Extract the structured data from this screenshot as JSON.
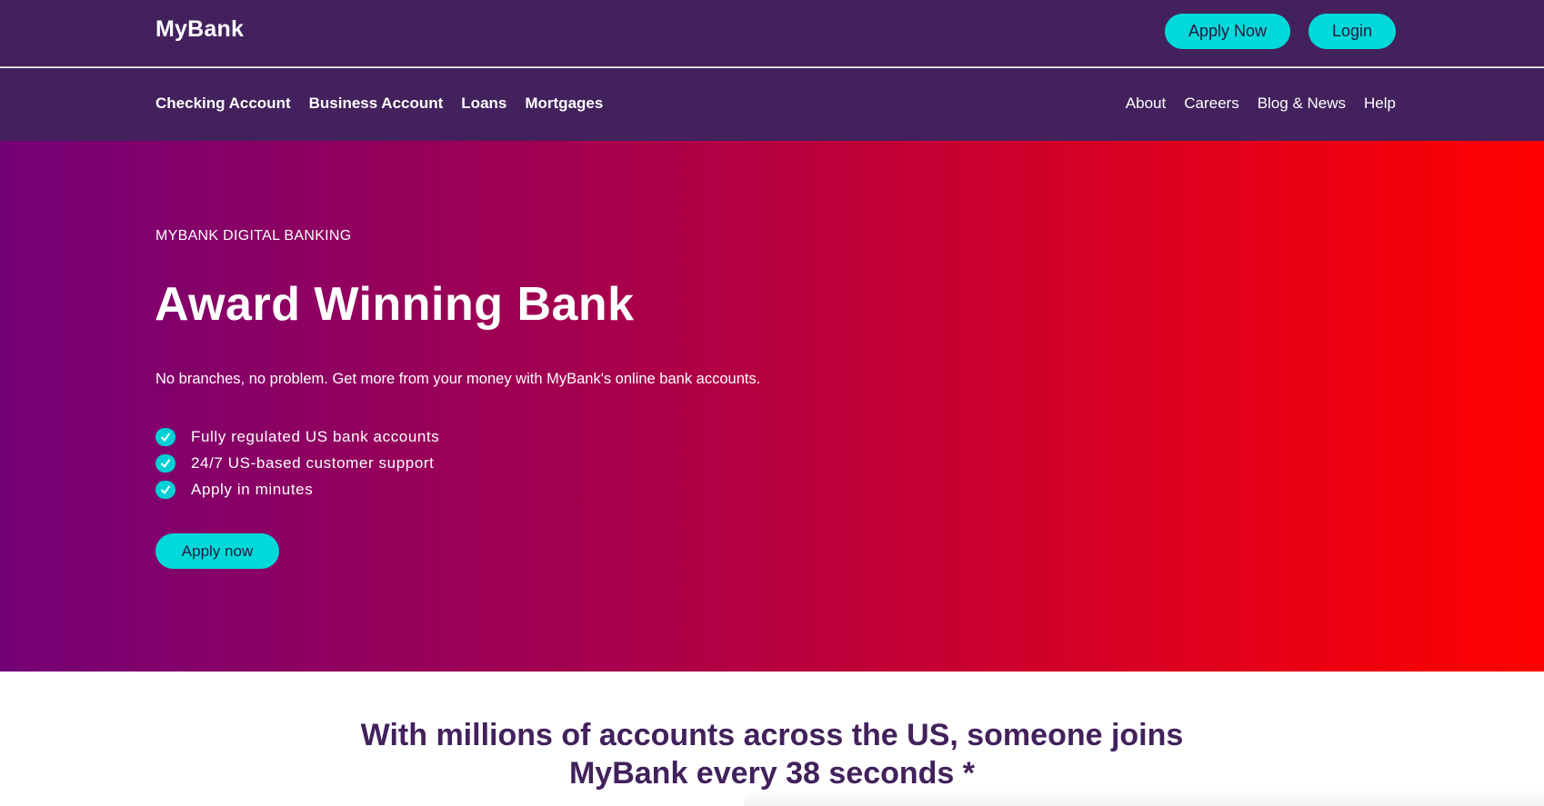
{
  "header": {
    "logo": "MyBank",
    "apply_label": "Apply Now",
    "login_label": "Login"
  },
  "nav": {
    "primary": [
      "Checking Account",
      "Business Account",
      "Loans",
      "Mortgages"
    ],
    "secondary": [
      "About",
      "Careers",
      "Blog & News",
      "Help"
    ]
  },
  "hero": {
    "eyebrow": "MYBANK DIGITAL BANKING",
    "title": "Award Winning Bank",
    "subtitle": "No branches, no problem. Get more from your money with MyBank's online bank accounts.",
    "features": [
      "Fully regulated US bank accounts",
      "24/7 US-based customer support",
      "Apply in minutes"
    ],
    "cta_label": "Apply now",
    "gradient_colors": [
      "#740076",
      "#a8004c",
      "#d40026",
      "#ff0000"
    ]
  },
  "stats": {
    "line1": "With millions of accounts across the US, someone joins",
    "line2": "MyBank every 38 seconds *"
  },
  "colors": {
    "brand_dark": "#42215c",
    "accent": "#00d9d9",
    "hero_start": "#740076",
    "hero_end": "#ff0000"
  },
  "icons": {
    "feature_check": "check-circle-icon"
  }
}
